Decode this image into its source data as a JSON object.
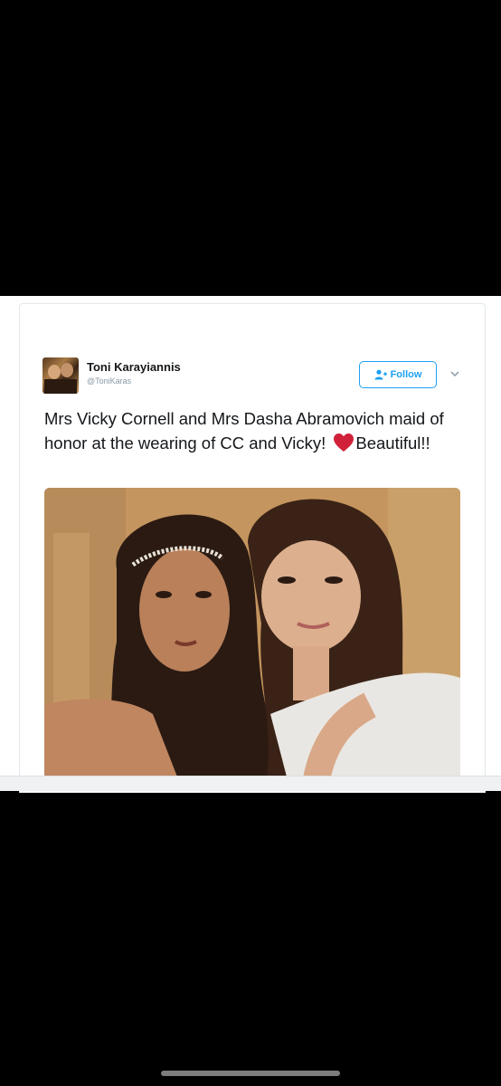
{
  "tweet": {
    "display_name": "Toni Karayiannis",
    "handle": "@ToniKaras",
    "follow_label": "Follow",
    "text_before_heart": "Mrs Vicky Cornell and Mrs Dasha Abramovich maid of honor at the wearing of CC and Vicky! ",
    "text_after_heart": "Beautiful!!"
  },
  "icons": {
    "follow": "add-user-icon",
    "menu": "chevron-down-icon",
    "heart": "heart-icon"
  },
  "colors": {
    "accent": "#1da1f2",
    "heart": "#e0245e",
    "text": "#14171a",
    "muted": "#8899a6",
    "background": "#000000"
  }
}
